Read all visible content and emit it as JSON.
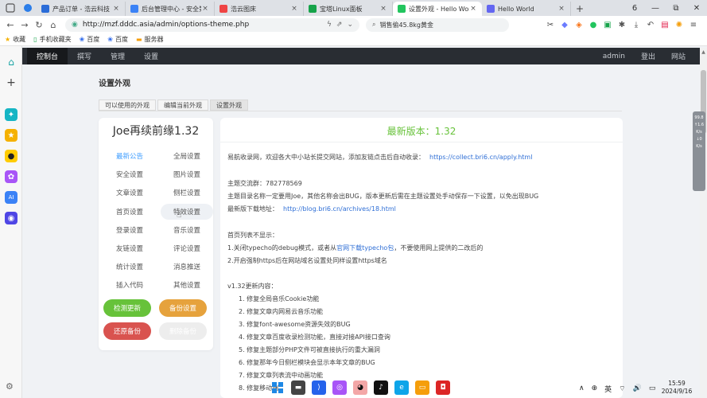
{
  "browser": {
    "tabs": [
      {
        "label": "产品订单 - 浩云科技",
        "color": "#2b6cd8",
        "active": false
      },
      {
        "label": "后台管理中心 - 安全第...",
        "color": "#3b82f6",
        "active": false
      },
      {
        "label": "浩云图床",
        "color": "#ef4444",
        "active": false
      },
      {
        "label": "宝塔Linux面板",
        "color": "#16a34a",
        "active": false
      },
      {
        "label": "设置外观 - Hello World",
        "color": "#22c55e",
        "active": true
      },
      {
        "label": "Hello World",
        "color": "#6366f1",
        "active": false
      }
    ],
    "tab_close": "×",
    "new_tab": "+",
    "tab_count": "6",
    "window_controls": [
      "—",
      "⧉",
      "✕"
    ],
    "url": "http://mzf.dddc.asia/admin/options-theme.php",
    "search_text": "销售偷45.8kg黄金",
    "bookmarks": [
      {
        "label": "收藏",
        "icon": "star-icon"
      },
      {
        "label": "手机收藏夹",
        "icon": "phone-icon"
      },
      {
        "label": "百度",
        "icon": "paw-icon"
      },
      {
        "label": "百度",
        "icon": "paw-icon"
      },
      {
        "label": "服务器",
        "icon": "folder-icon"
      }
    ]
  },
  "admin_nav": {
    "left": [
      {
        "label": "控制台",
        "active": true
      },
      {
        "label": "撰写",
        "active": false
      },
      {
        "label": "管理",
        "active": false
      },
      {
        "label": "设置",
        "active": false
      }
    ],
    "right": [
      "admin",
      "登出",
      "网站"
    ]
  },
  "page": {
    "title": "设置外观",
    "subtabs": [
      {
        "label": "可以使用的外观",
        "current": false
      },
      {
        "label": "编辑当前外观",
        "current": false
      },
      {
        "label": "设置外观",
        "current": true
      }
    ]
  },
  "panel": {
    "title": "Joe再续前缘1.32",
    "menu": [
      {
        "label": "最新公告",
        "active": true,
        "hover": false
      },
      {
        "label": "全局设置",
        "active": false,
        "hover": false
      },
      {
        "label": "安全设置",
        "active": false,
        "hover": false
      },
      {
        "label": "图片设置",
        "active": false,
        "hover": false
      },
      {
        "label": "文章设置",
        "active": false,
        "hover": false
      },
      {
        "label": "侧栏设置",
        "active": false,
        "hover": false
      },
      {
        "label": "首页设置",
        "active": false,
        "hover": false
      },
      {
        "label": "特效设置",
        "active": false,
        "hover": true
      },
      {
        "label": "登录设置",
        "active": false,
        "hover": false
      },
      {
        "label": "音乐设置",
        "active": false,
        "hover": false
      },
      {
        "label": "友链设置",
        "active": false,
        "hover": false
      },
      {
        "label": "评论设置",
        "active": false,
        "hover": false
      },
      {
        "label": "统计设置",
        "active": false,
        "hover": false
      },
      {
        "label": "消息推送",
        "active": false,
        "hover": false
      },
      {
        "label": "插入代码",
        "active": false,
        "hover": false
      },
      {
        "label": "其他设置",
        "active": false,
        "hover": false
      }
    ],
    "buttons": [
      {
        "label": "检测更新",
        "color": "#67c23a"
      },
      {
        "label": "备份设置",
        "color": "#e6a23c"
      },
      {
        "label": "还原备份",
        "color": "#d9534f"
      },
      {
        "label": "删除备份",
        "color": "#ededed"
      }
    ]
  },
  "content": {
    "title": "最新版本：1.32",
    "title_color": "#67c23a",
    "lines": [
      {
        "text": "易航收录网，欢迎各大中小站长提交网站，添加友链点击后自动收录：",
        "link": "https://collect.bri6.cn/apply.html",
        "indent": false
      },
      {
        "text": "主题交流群：782778569",
        "link": "",
        "indent": false
      },
      {
        "text": "主题目录名称一定要用Joe，其他名称会出BUG，版本更新后需在主题设置处手动保存一下设置，以免出现BUG",
        "link": "",
        "indent": false
      },
      {
        "text": "最新版下载地址：",
        "link": "http://blog.bri6.cn/archives/18.html",
        "indent": false
      },
      {
        "text": "首页列表不显示：",
        "link": "",
        "indent": false
      },
      {
        "text": "1.关闭typecho的debug模式，或者从",
        "link": "官网下载typecho包",
        "suffix": "，不要使用网上提供的二改后的",
        "indent": false
      },
      {
        "text": "2.开启强制https后在网站域名设置处同样设置https域名",
        "link": "",
        "indent": false
      },
      {
        "text": "v1.32更新内容：",
        "link": "",
        "indent": false
      },
      {
        "text": "1. 修复全局音乐Cookie功能",
        "link": "",
        "indent": true
      },
      {
        "text": "2. 修复文章内网易云音乐功能",
        "link": "",
        "indent": true
      },
      {
        "text": "3. 修复font-awesome资源失效的BUG",
        "link": "",
        "indent": true
      },
      {
        "text": "4. 修复文章百度收录检测功能，直接对接API接口查询",
        "link": "",
        "indent": true
      },
      {
        "text": "5. 修复主题部分PHP文件可被直接执行的重大漏洞",
        "link": "",
        "indent": true
      },
      {
        "text": "6. 修复那年今日侧栏模块会显示本年文章的BUG",
        "link": "",
        "indent": true
      },
      {
        "text": "7. 修复文章列表流中动画功能",
        "link": "",
        "indent": true
      },
      {
        "text": "8. 修复移动端",
        "link": "",
        "indent": true
      }
    ]
  },
  "system": {
    "tray": [
      "∧",
      "⊕",
      "英",
      "⌔",
      "🔊",
      "▭"
    ],
    "time": "15:59",
    "date": "2024/9/16",
    "widget": [
      "99.8",
      "↑1.6",
      "K/s",
      "↓0",
      "K/s"
    ]
  }
}
